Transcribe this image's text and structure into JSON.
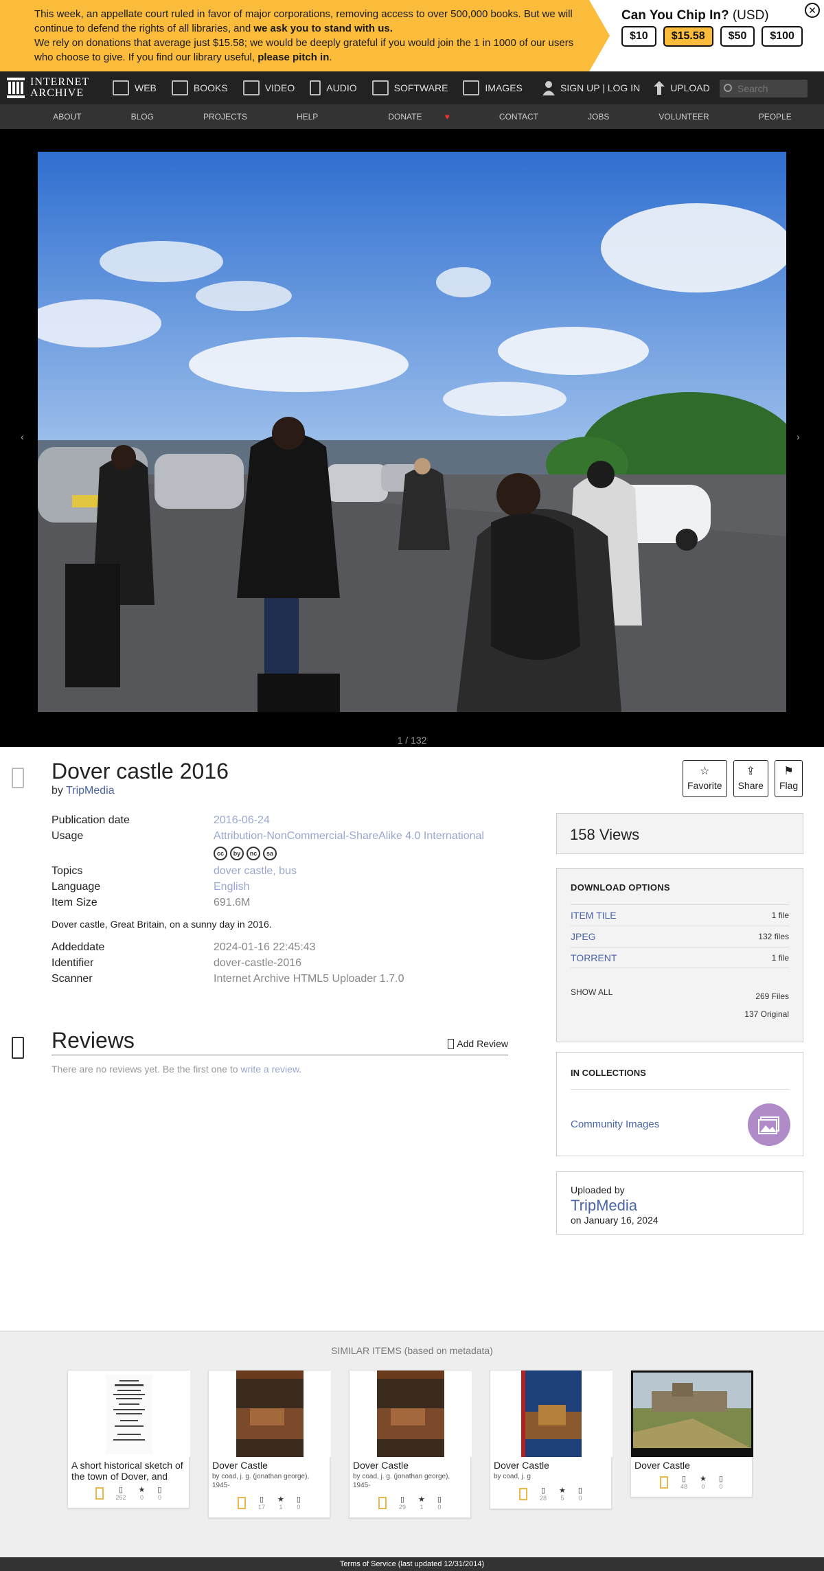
{
  "banner": {
    "line1_a": "This week, an appellate court ruled in favor of major corporations, removing access to over 500,000 books. But we will continue to defend the rights of all libraries, and ",
    "line1_b": "we ask you to stand with us.",
    "line2_a": "We rely on donations that average just $15.58; we would be deeply grateful if you would join the 1 in 1000 of our users who choose to give. If you find our library useful, ",
    "line2_b": "please pitch in",
    "line2_c": ".",
    "chip_title": "Can You Chip In?",
    "chip_currency": "(USD)",
    "amounts": [
      "$10",
      "$15.58",
      "$50",
      "$100"
    ],
    "close": "✕"
  },
  "nav": {
    "logo_line1": "INTERNET",
    "logo_line2": "ARCHIVE",
    "items": [
      "WEB",
      "BOOKS",
      "VIDEO",
      "AUDIO",
      "SOFTWARE",
      "IMAGES"
    ],
    "signup": "SIGN UP | LOG IN",
    "upload": "UPLOAD",
    "search_placeholder": "Search"
  },
  "subnav": [
    "ABOUT",
    "BLOG",
    "PROJECTS",
    "HELP",
    "DONATE",
    "CONTACT",
    "JOBS",
    "VOLUNTEER",
    "PEOPLE"
  ],
  "viewer": {
    "prev": "‹",
    "next": "›",
    "page_count": "1 / 132"
  },
  "item": {
    "title": "Dover castle 2016",
    "by_label": "by ",
    "by": "TripMedia",
    "actions": [
      {
        "icon": "☆",
        "label": "Favorite"
      },
      {
        "icon": "⇪",
        "label": "Share"
      },
      {
        "icon": "⚑",
        "label": "Flag"
      }
    ]
  },
  "metadata": {
    "publication_date_label": "Publication date",
    "publication_date": "2016-06-24",
    "usage_label": "Usage",
    "usage": "Attribution-NonCommercial-ShareAlike 4.0 International",
    "cc_icons": [
      "cc",
      "by",
      "nc",
      "sa"
    ],
    "topics_label": "Topics",
    "topics": "dover castle, bus",
    "language_label": "Language",
    "language": "English",
    "item_size_label": "Item Size",
    "item_size": "691.6M",
    "description": "Dover castle, Great Britain, on a sunny day in 2016.",
    "addeddate_label": "Addeddate",
    "addeddate": "2024-01-16 22:45:43",
    "identifier_label": "Identifier",
    "identifier": "dover-castle-2016",
    "scanner_label": "Scanner",
    "scanner": "Internet Archive HTML5 Uploader 1.7.0"
  },
  "reviews": {
    "title": "Reviews",
    "add": "Add Review",
    "none_text": "There are no reviews yet. Be the first one to ",
    "none_link": "write a review",
    "none_end": "."
  },
  "sidebar": {
    "views": "158 Views",
    "download_title": "DOWNLOAD OPTIONS",
    "downloads": [
      {
        "label": "ITEM TILE",
        "count": "1 file"
      },
      {
        "label": "JPEG",
        "count": "132 files"
      },
      {
        "label": "TORRENT",
        "count": "1 file"
      }
    ],
    "show_all": "SHOW ALL",
    "total_files": "269 Files",
    "original": "137 Original",
    "collections_title": "IN COLLECTIONS",
    "collection": "Community Images",
    "uploaded_by_label": "Uploaded by",
    "uploader": "TripMedia",
    "uploaded_on": "on January 16, 2024"
  },
  "similar": {
    "title": "SIMILAR ITEMS (based on metadata)",
    "cards": [
      {
        "title": "A short historical sketch of the town of Dover, and",
        "by": "",
        "views": "262",
        "favs": "0",
        "reviews": "0"
      },
      {
        "title": "Dover Castle",
        "by": "by coad, j. g. (jonathan george), 1945-",
        "views": "17",
        "favs": "1",
        "reviews": "0"
      },
      {
        "title": "Dover Castle",
        "by": "by coad, j. g. (jonathan george), 1945-",
        "views": "29",
        "favs": "1",
        "reviews": "0"
      },
      {
        "title": "Dover Castle",
        "by": "by coad, j. g",
        "views": "28",
        "favs": "5",
        "reviews": "0"
      },
      {
        "title": "Dover Castle",
        "by": "",
        "views": "48",
        "favs": "0",
        "reviews": "0"
      }
    ]
  },
  "footer": "Terms of Service (last updated 12/31/2014)",
  "colors": {
    "banner": "#fbbc3c",
    "link": "#4b64a7",
    "nav_bg": "#222222"
  }
}
